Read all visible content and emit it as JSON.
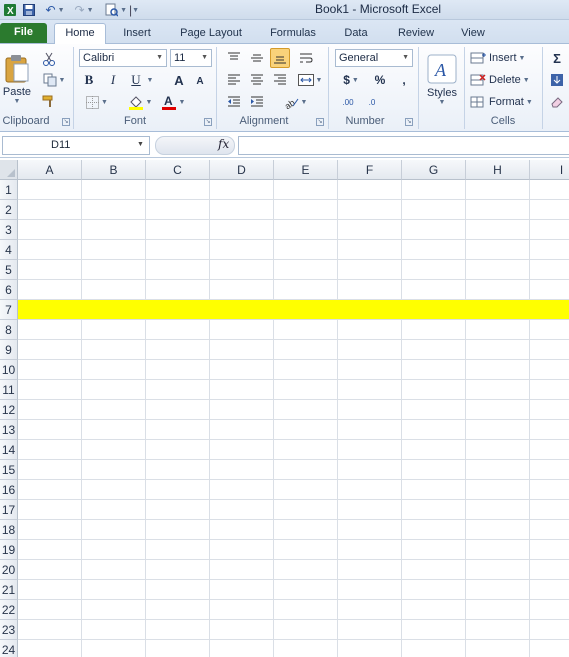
{
  "title_bar": {
    "title": "Book1 - Microsoft Excel",
    "quick_access": [
      "excel-logo-icon",
      "save-icon",
      "undo-icon",
      "redo-icon",
      "print-preview-icon",
      "customize-qat-icon"
    ]
  },
  "tabs": [
    {
      "label": "File"
    },
    {
      "label": "Home"
    },
    {
      "label": "Insert"
    },
    {
      "label": "Page Layout"
    },
    {
      "label": "Formulas"
    },
    {
      "label": "Data"
    },
    {
      "label": "Review"
    },
    {
      "label": "View"
    }
  ],
  "ribbon": {
    "clipboard": {
      "label": "Clipboard",
      "paste": "Paste"
    },
    "font": {
      "label": "Font",
      "name": "Calibri",
      "size": "11",
      "bold": "B",
      "italic": "I",
      "underline": "U",
      "grow": "A",
      "shrink": "A",
      "color_a": "A",
      "fill_color": "#ffff00",
      "font_color": "#e00000"
    },
    "alignment": {
      "label": "Alignment"
    },
    "number": {
      "label": "Number",
      "format": "General",
      "currency": "$",
      "percent": "%",
      "comma": ",",
      "inc_dec": ".00",
      "dec_dec": ".0"
    },
    "styles": {
      "label": "Styles"
    },
    "cells": {
      "label": "Cells",
      "insert": "Insert",
      "delete": "Delete",
      "format": "Format"
    },
    "editing": {
      "sigma": "Σ"
    }
  },
  "formula_bar": {
    "name_box": "D11",
    "fx": "fx",
    "content": ""
  },
  "sheet": {
    "columns": [
      "A",
      "B",
      "C",
      "D",
      "E",
      "F",
      "G",
      "H",
      "I"
    ],
    "rows": [
      "1",
      "2",
      "3",
      "4",
      "5",
      "6",
      "7",
      "8",
      "9",
      "10",
      "11",
      "12",
      "13",
      "14",
      "15",
      "16",
      "17",
      "18",
      "19",
      "20",
      "21",
      "22",
      "23",
      "24"
    ],
    "highlighted_row": "7",
    "highlight_color": "#ffff00"
  }
}
